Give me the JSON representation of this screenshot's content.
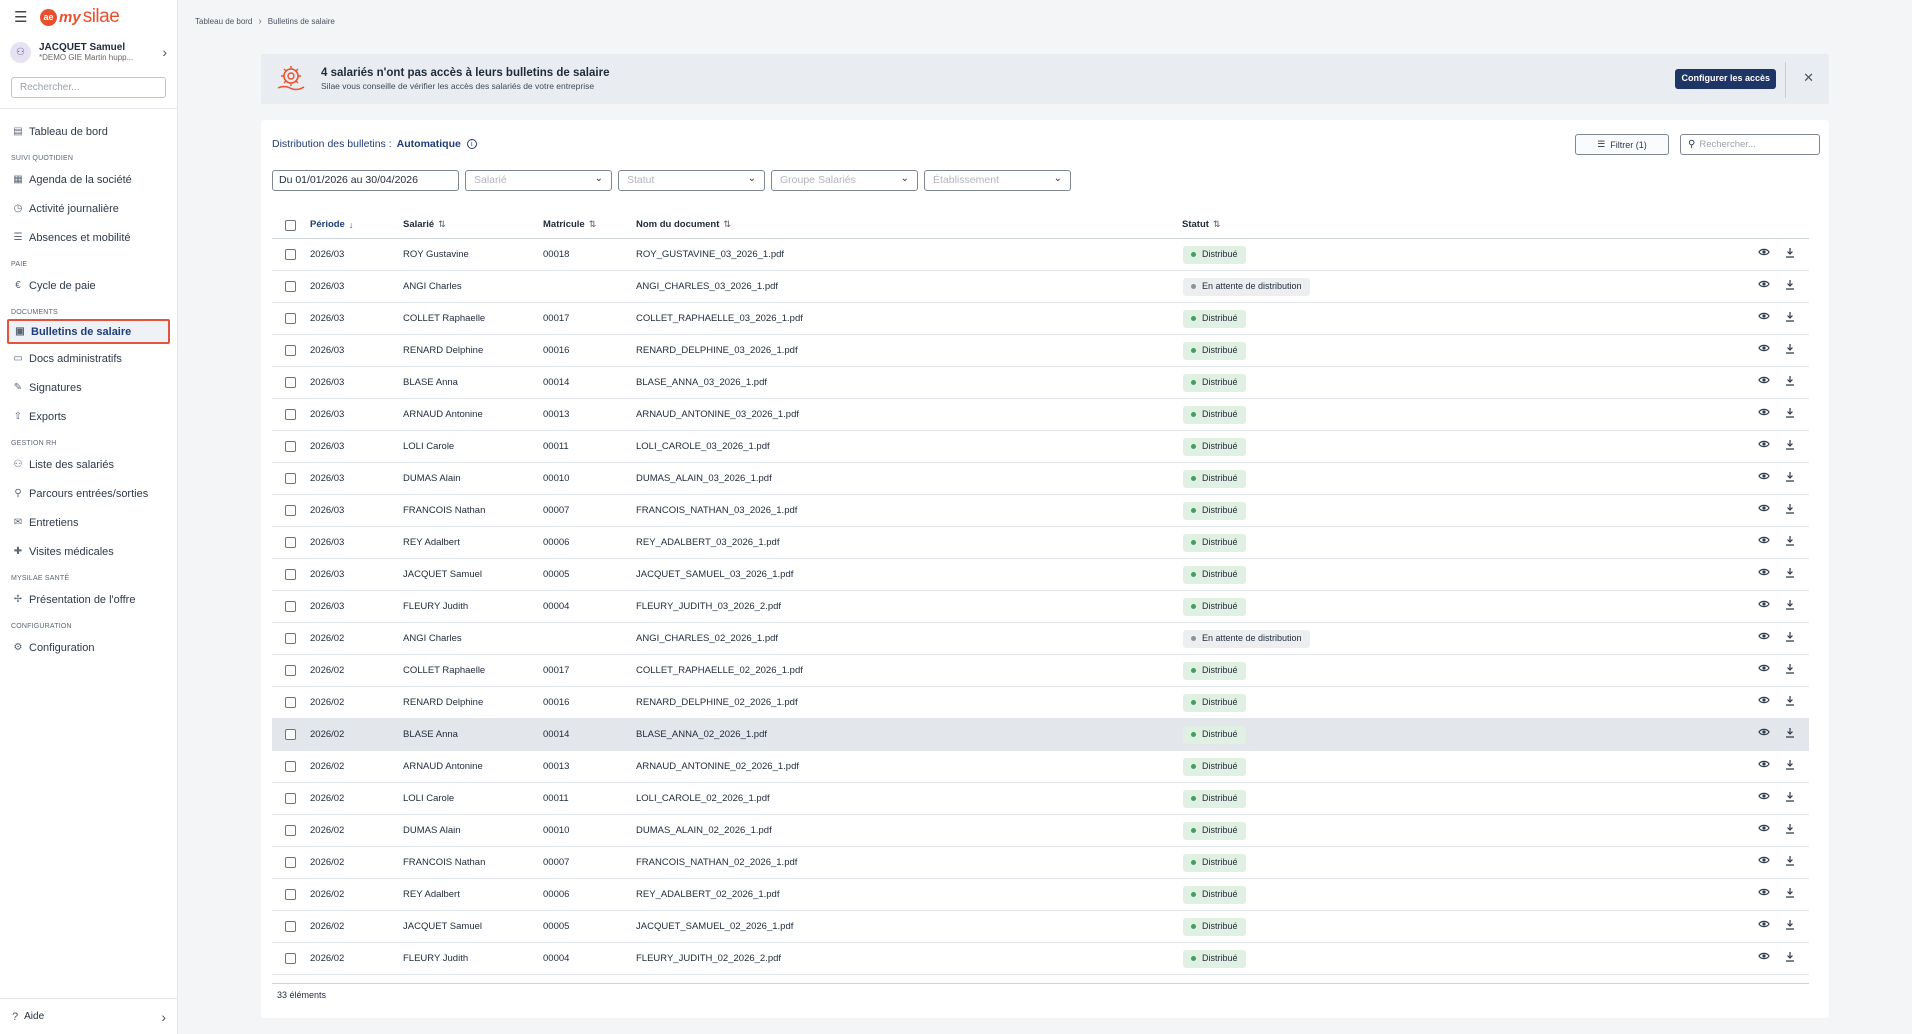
{
  "sidebar": {
    "logo_ae": "ae",
    "logo_my": "my",
    "logo_silae": "silae",
    "user": {
      "name": "JACQUET Samuel",
      "company": "*DEMO GIE Martin hupp..."
    },
    "search_placeholder": "Rechercher...",
    "items": [
      {
        "kind": "item",
        "label": "Tableau de bord",
        "icon": "dashboard-icon",
        "glyph": "▤"
      },
      {
        "kind": "section",
        "label": "SUIVI QUOTIDIEN"
      },
      {
        "kind": "item",
        "label": "Agenda de la société",
        "icon": "calendar-icon",
        "glyph": "▦"
      },
      {
        "kind": "item",
        "label": "Activité journalière",
        "icon": "clock-icon",
        "glyph": "◷"
      },
      {
        "kind": "item",
        "label": "Absences et mobilité",
        "icon": "list-icon",
        "glyph": "☰"
      },
      {
        "kind": "section",
        "label": "PAIE"
      },
      {
        "kind": "item",
        "label": "Cycle de paie",
        "icon": "euro-icon",
        "glyph": "€"
      },
      {
        "kind": "section",
        "label": "DOCUMENTS"
      },
      {
        "kind": "item",
        "label": "Bulletins de salaire",
        "icon": "document-icon",
        "glyph": "▣",
        "active": true
      },
      {
        "kind": "item",
        "label": "Docs administratifs",
        "icon": "folder-icon",
        "glyph": "▭"
      },
      {
        "kind": "item",
        "label": "Signatures",
        "icon": "pen-icon",
        "glyph": "✎"
      },
      {
        "kind": "item",
        "label": "Exports",
        "icon": "export-icon",
        "glyph": "⇧"
      },
      {
        "kind": "section",
        "label": "GESTION RH"
      },
      {
        "kind": "item",
        "label": "Liste des salariés",
        "icon": "users-icon",
        "glyph": "⚇"
      },
      {
        "kind": "item",
        "label": "Parcours entrées/sorties",
        "icon": "user-path-icon",
        "glyph": "⚲"
      },
      {
        "kind": "item",
        "label": "Entretiens",
        "icon": "chat-icon",
        "glyph": "✉"
      },
      {
        "kind": "item",
        "label": "Visites médicales",
        "icon": "medical-icon",
        "glyph": "✚"
      },
      {
        "kind": "section",
        "label": "MYSILAE SANTÉ"
      },
      {
        "kind": "item",
        "label": "Présentation de l'offre",
        "icon": "health-icon",
        "glyph": "✢"
      },
      {
        "kind": "section",
        "label": "CONFIGURATION"
      },
      {
        "kind": "item",
        "label": "Configuration",
        "icon": "gear-icon",
        "glyph": "⚙"
      }
    ],
    "aide": "Aide"
  },
  "breadcrumb": [
    "Tableau de bord",
    "Bulletins de salaire"
  ],
  "banner": {
    "title": "4 salariés n'ont pas accès à leurs bulletins de salaire",
    "subtitle": "Silae vous conseille de vérifier les accès des salariés de votre entreprise",
    "button": "Configurer les accès"
  },
  "toolbar": {
    "distribution_label": "Distribution des bulletins :",
    "distribution_value": "Automatique",
    "filter_button": "Filtrer (1)",
    "search_placeholder": "Rechercher..."
  },
  "filters": {
    "date_range": "Du 01/01/2026 au 30/04/2026",
    "salarie": "Salarié",
    "statut": "Statut",
    "groupe": "Groupe Salariés",
    "etablissement": "Établissement"
  },
  "table": {
    "columns": [
      "Période",
      "Salarié",
      "Matricule",
      "Nom du document",
      "Statut"
    ],
    "rows": [
      {
        "periode": "2026/03",
        "salarie": "ROY Gustavine",
        "matricule": "00018",
        "document": "ROY_GUSTAVINE_03_2026_1.pdf",
        "statut": "Distribué"
      },
      {
        "periode": "2026/03",
        "salarie": "ANGI Charles",
        "matricule": "",
        "document": "ANGI_CHARLES_03_2026_1.pdf",
        "statut": "En attente de distribution"
      },
      {
        "periode": "2026/03",
        "salarie": "COLLET Raphaelle",
        "matricule": "00017",
        "document": "COLLET_RAPHAELLE_03_2026_1.pdf",
        "statut": "Distribué"
      },
      {
        "periode": "2026/03",
        "salarie": "RENARD Delphine",
        "matricule": "00016",
        "document": "RENARD_DELPHINE_03_2026_1.pdf",
        "statut": "Distribué"
      },
      {
        "periode": "2026/03",
        "salarie": "BLASE Anna",
        "matricule": "00014",
        "document": "BLASE_ANNA_03_2026_1.pdf",
        "statut": "Distribué"
      },
      {
        "periode": "2026/03",
        "salarie": "ARNAUD Antonine",
        "matricule": "00013",
        "document": "ARNAUD_ANTONINE_03_2026_1.pdf",
        "statut": "Distribué"
      },
      {
        "periode": "2026/03",
        "salarie": "LOLI Carole",
        "matricule": "00011",
        "document": "LOLI_CAROLE_03_2026_1.pdf",
        "statut": "Distribué"
      },
      {
        "periode": "2026/03",
        "salarie": "DUMAS Alain",
        "matricule": "00010",
        "document": "DUMAS_ALAIN_03_2026_1.pdf",
        "statut": "Distribué"
      },
      {
        "periode": "2026/03",
        "salarie": "FRANCOIS Nathan",
        "matricule": "00007",
        "document": "FRANCOIS_NATHAN_03_2026_1.pdf",
        "statut": "Distribué"
      },
      {
        "periode": "2026/03",
        "salarie": "REY Adalbert",
        "matricule": "00006",
        "document": "REY_ADALBERT_03_2026_1.pdf",
        "statut": "Distribué"
      },
      {
        "periode": "2026/03",
        "salarie": "JACQUET Samuel",
        "matricule": "00005",
        "document": "JACQUET_SAMUEL_03_2026_1.pdf",
        "statut": "Distribué"
      },
      {
        "periode": "2026/03",
        "salarie": "FLEURY Judith",
        "matricule": "00004",
        "document": "FLEURY_JUDITH_03_2026_2.pdf",
        "statut": "Distribué"
      },
      {
        "periode": "2026/02",
        "salarie": "ANGI Charles",
        "matricule": "",
        "document": "ANGI_CHARLES_02_2026_1.pdf",
        "statut": "En attente de distribution"
      },
      {
        "periode": "2026/02",
        "salarie": "COLLET Raphaelle",
        "matricule": "00017",
        "document": "COLLET_RAPHAELLE_02_2026_1.pdf",
        "statut": "Distribué"
      },
      {
        "periode": "2026/02",
        "salarie": "RENARD Delphine",
        "matricule": "00016",
        "document": "RENARD_DELPHINE_02_2026_1.pdf",
        "statut": "Distribué"
      },
      {
        "periode": "2026/02",
        "salarie": "BLASE Anna",
        "matricule": "00014",
        "document": "BLASE_ANNA_02_2026_1.pdf",
        "statut": "Distribué",
        "highlighted": true
      },
      {
        "periode": "2026/02",
        "salarie": "ARNAUD Antonine",
        "matricule": "00013",
        "document": "ARNAUD_ANTONINE_02_2026_1.pdf",
        "statut": "Distribué"
      },
      {
        "periode": "2026/02",
        "salarie": "LOLI Carole",
        "matricule": "00011",
        "document": "LOLI_CAROLE_02_2026_1.pdf",
        "statut": "Distribué"
      },
      {
        "periode": "2026/02",
        "salarie": "DUMAS Alain",
        "matricule": "00010",
        "document": "DUMAS_ALAIN_02_2026_1.pdf",
        "statut": "Distribué"
      },
      {
        "periode": "2026/02",
        "salarie": "FRANCOIS Nathan",
        "matricule": "00007",
        "document": "FRANCOIS_NATHAN_02_2026_1.pdf",
        "statut": "Distribué"
      },
      {
        "periode": "2026/02",
        "salarie": "REY Adalbert",
        "matricule": "00006",
        "document": "REY_ADALBERT_02_2026_1.pdf",
        "statut": "Distribué"
      },
      {
        "periode": "2026/02",
        "salarie": "JACQUET Samuel",
        "matricule": "00005",
        "document": "JACQUET_SAMUEL_02_2026_1.pdf",
        "statut": "Distribué"
      },
      {
        "periode": "2026/02",
        "salarie": "FLEURY Judith",
        "matricule": "00004",
        "document": "FLEURY_JUDITH_02_2026_2.pdf",
        "statut": "Distribué"
      }
    ],
    "footer": "33 éléments"
  },
  "colors": {
    "accent": "#1f3566",
    "brand": "#e8502e",
    "active_outline": "#e3553b",
    "badge_ok": "#e0f0e3",
    "badge_wait": "#eceef0"
  }
}
